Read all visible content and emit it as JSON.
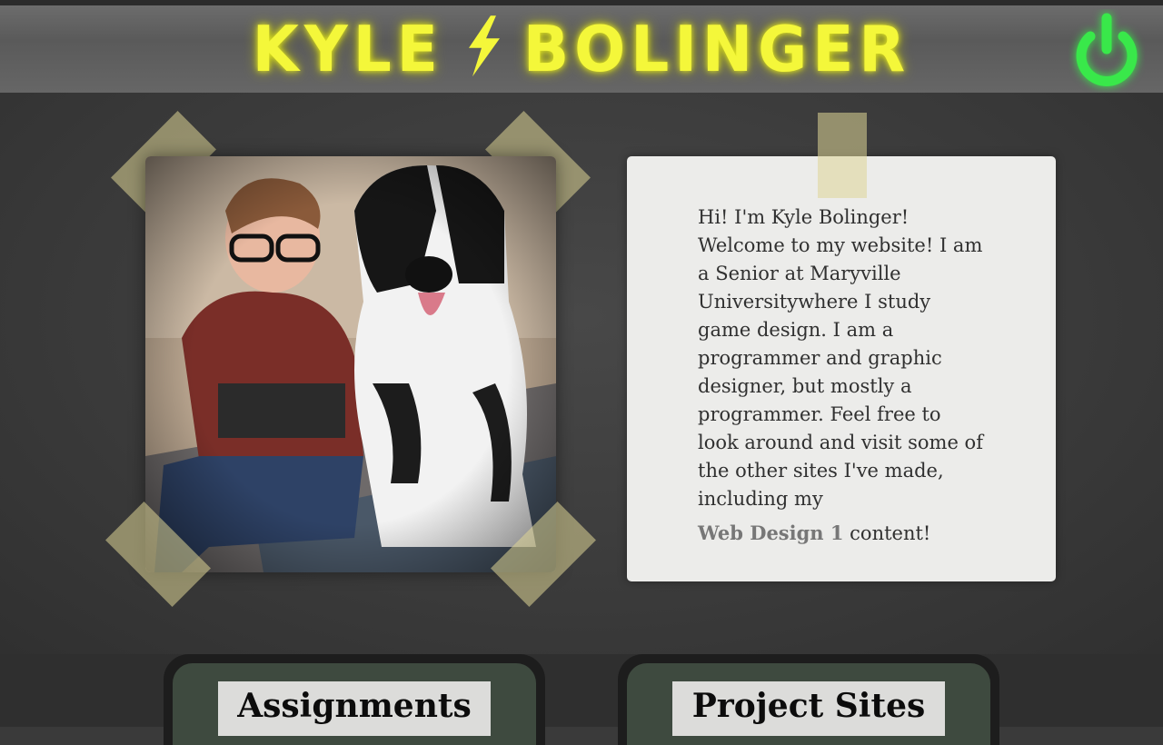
{
  "header": {
    "title_first": "KYLE",
    "title_last": "BOLINGER",
    "power_icon": "power-icon",
    "colors": {
      "title": "#f4f73a",
      "power": "#39e84a"
    }
  },
  "about": {
    "photo_icon": "photo-of-kyle-with-dog-statue",
    "text_before_link": "Hi! I'm Kyle Bolinger! Welcome to my website! I am a Senior at Maryville Universitywhere I study game design. I am a programmer and graphic designer, but mostly a programmer. Feel free to look around and visit some of the other sites I've made, including my",
    "link_label": "Web Design 1",
    "text_after_link": " content!"
  },
  "nav": {
    "assignments_label": "Assignments",
    "projects_label": "Project Sites"
  }
}
